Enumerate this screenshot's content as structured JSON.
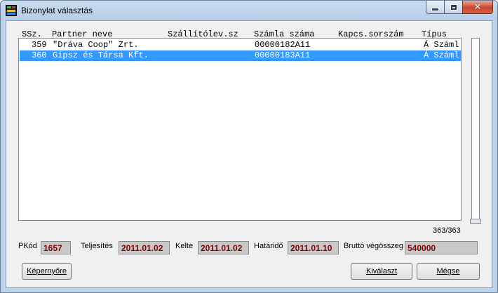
{
  "window": {
    "title": "Bizonylat választás"
  },
  "columns": [
    "SSz.",
    "Partner neve",
    "Szállítólev.sz",
    "Számla száma",
    "Kapcs.sorszám",
    "Típus"
  ],
  "rows": [
    {
      "ssz": "359",
      "partner": "\"Dráva Coop\" Zrt.",
      "szallitolev": "",
      "szamla": "00000182A11",
      "kapcs": "",
      "tipus": "Á Száml",
      "selected": false
    },
    {
      "ssz": "360",
      "partner": "Gipsz és Társa Kft.",
      "szallitolev": "",
      "szamla": "00000183A11",
      "kapcs": "",
      "tipus": "Á Száml",
      "selected": true
    }
  ],
  "record_count": "363/363",
  "fields": {
    "pkod": {
      "label": "PKód",
      "value": "1657"
    },
    "teljesites": {
      "label": "Teljesítés",
      "value": "2011.01.02"
    },
    "kelte": {
      "label": "Kelte",
      "value": "2011.01.02"
    },
    "hatarido": {
      "label": "Határidő",
      "value": "2011.01.10"
    },
    "brutto": {
      "label": "Bruttó végösszeg",
      "value": "540000"
    }
  },
  "buttons": {
    "kepernyore": "Képernyőre",
    "kivalaszt": "Kiválaszt",
    "megse": "Mégse"
  },
  "colors": {
    "selection": "#3399ff",
    "field_value": "#800000",
    "field_bg": "#c9c9c9"
  }
}
